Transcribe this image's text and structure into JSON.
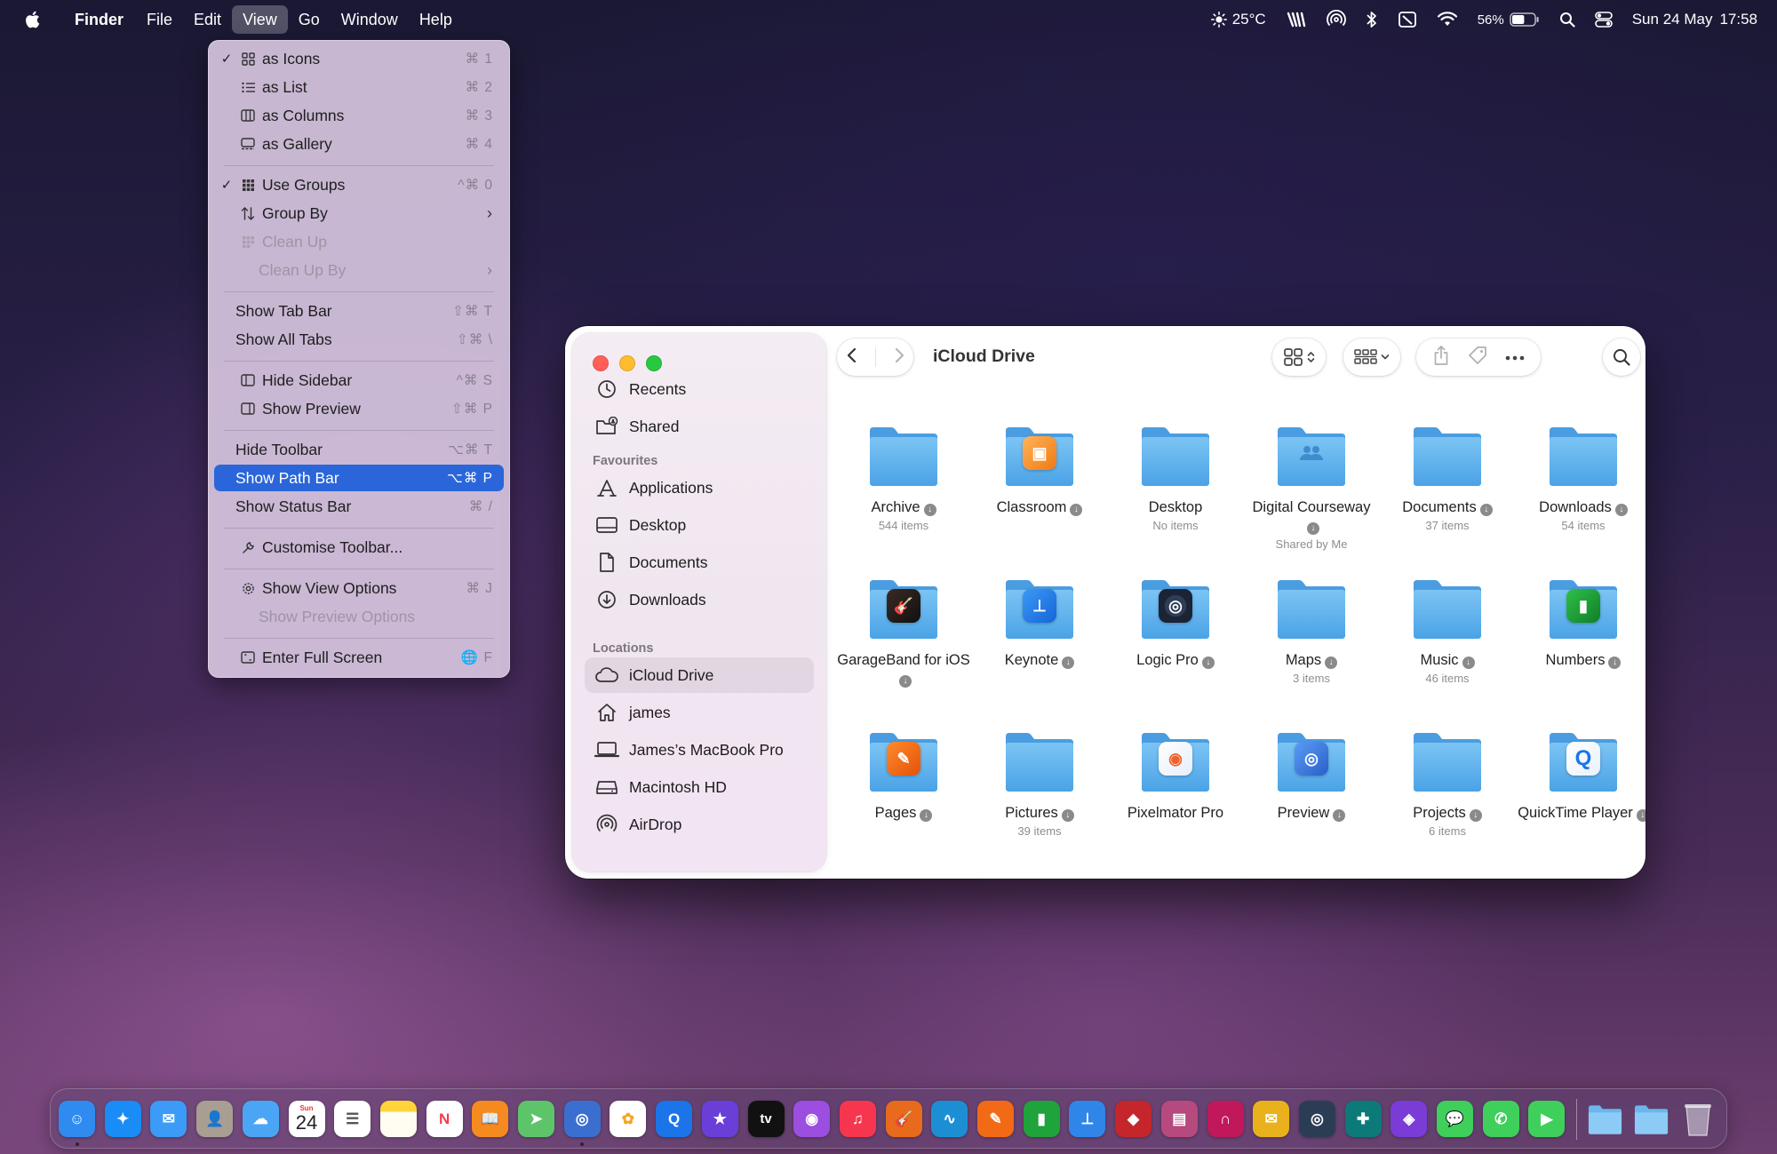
{
  "menubar": {
    "app_name": "Finder",
    "menus": [
      "File",
      "Edit",
      "View",
      "Go",
      "Window",
      "Help"
    ],
    "active_menu": "View",
    "weather": "25°C",
    "battery_percent": "56%",
    "battery_level": 0.56,
    "date": "Sun 24 May",
    "time": "17:58",
    "status_icons": [
      "sun-icon",
      "aggregate-icon",
      "airdrop-icon",
      "bluetooth-icon",
      "focus-icon",
      "wifi-icon",
      "battery-icon",
      "search-icon",
      "control-center-icon"
    ]
  },
  "view_menu": {
    "items": [
      {
        "label": "as Icons",
        "shortcut": "⌘ 1",
        "checked": true,
        "icon": "grid-icon"
      },
      {
        "label": "as List",
        "shortcut": "⌘ 2",
        "icon": "list-icon"
      },
      {
        "label": "as Columns",
        "shortcut": "⌘ 3",
        "icon": "columns-icon"
      },
      {
        "label": "as Gallery",
        "shortcut": "⌘ 4",
        "icon": "gallery-icon"
      },
      {
        "label": "Use Groups",
        "shortcut": "^⌘ 0",
        "checked": true,
        "icon": "groups-icon"
      },
      {
        "label": "Group By",
        "submenu": true,
        "icon": "sort-icon"
      },
      {
        "label": "Clean Up",
        "disabled": true,
        "icon": "cleanup-icon"
      },
      {
        "label": "Clean Up By",
        "disabled": true,
        "submenu": true
      },
      {
        "label": "Show Tab Bar",
        "shortcut": "⇧⌘ T"
      },
      {
        "label": "Show All Tabs",
        "shortcut": "⇧⌘ \\"
      },
      {
        "label": "Hide Sidebar",
        "shortcut": "^⌘ S",
        "icon": "sidebar-icon"
      },
      {
        "label": "Show Preview",
        "shortcut": "⇧⌘ P",
        "icon": "preview-icon"
      },
      {
        "label": "Hide Toolbar",
        "shortcut": "⌥⌘ T"
      },
      {
        "label": "Show Path Bar",
        "shortcut": "⌥⌘ P",
        "highlighted": true
      },
      {
        "label": "Show Status Bar",
        "shortcut": "⌘ /"
      },
      {
        "label": "Customise Toolbar...",
        "icon": "wrench-icon"
      },
      {
        "label": "Show View Options",
        "shortcut": "⌘ J",
        "icon": "gear-icon"
      },
      {
        "label": "Show Preview Options",
        "disabled": true
      },
      {
        "label": "Enter Full Screen",
        "shortcut": "🌐 F",
        "icon": "fullscreen-icon"
      }
    ]
  },
  "finder": {
    "title": "iCloud Drive",
    "sidebar": {
      "top_items": [
        {
          "label": "Recents",
          "icon": "clock-icon"
        },
        {
          "label": "Shared",
          "icon": "shared-folder-icon"
        }
      ],
      "favourites_header": "Favourites",
      "favourites": [
        {
          "label": "Applications",
          "icon": "applications-icon"
        },
        {
          "label": "Desktop",
          "icon": "desktop-icon"
        },
        {
          "label": "Documents",
          "icon": "document-icon"
        },
        {
          "label": "Downloads",
          "icon": "download-icon"
        }
      ],
      "locations_header": "Locations",
      "locations": [
        {
          "label": "iCloud Drive",
          "icon": "cloud-icon",
          "selected": true
        },
        {
          "label": "james",
          "icon": "home-icon"
        },
        {
          "label": "James’s MacBook Pro",
          "icon": "laptop-icon"
        },
        {
          "label": "Macintosh HD",
          "icon": "disk-icon"
        },
        {
          "label": "AirDrop",
          "icon": "airdrop-icon"
        }
      ]
    },
    "items": [
      {
        "name": "Archive",
        "sub": "544 items",
        "badge": ""
      },
      {
        "name": "Classroom",
        "sub": "",
        "badge": "classroom"
      },
      {
        "name": "Desktop",
        "sub": "No items",
        "badge": "",
        "no_download": true
      },
      {
        "name": "Digital Courseway",
        "sub": "Shared by Me",
        "badge": "people"
      },
      {
        "name": "Documents",
        "sub": "37 items",
        "badge": ""
      },
      {
        "name": "Downloads",
        "sub": "54 items",
        "badge": ""
      },
      {
        "name": "GarageBand for iOS",
        "sub": "",
        "badge": "garageband"
      },
      {
        "name": "Keynote",
        "sub": "",
        "badge": "keynote"
      },
      {
        "name": "Logic Pro",
        "sub": "",
        "badge": "logic"
      },
      {
        "name": "Maps",
        "sub": "3 items",
        "badge": ""
      },
      {
        "name": "Music",
        "sub": "46 items",
        "badge": ""
      },
      {
        "name": "Numbers",
        "sub": "",
        "badge": "numbers"
      },
      {
        "name": "Pages",
        "sub": "",
        "badge": "pages"
      },
      {
        "name": "Pictures",
        "sub": "39 items",
        "badge": ""
      },
      {
        "name": "Pixelmator Pro",
        "sub": "",
        "badge": "pixelmator",
        "no_download": true
      },
      {
        "name": "Preview",
        "sub": "",
        "badge": "preview"
      },
      {
        "name": "Projects",
        "sub": "6 items",
        "badge": ""
      },
      {
        "name": "QuickTime Player",
        "sub": "",
        "badge": "quicktime"
      }
    ]
  },
  "dock": {
    "calendar_month": "Sun",
    "calendar_day": "24",
    "tv_label": "tv",
    "apps": [
      {
        "name": "finder-icon",
        "color": "#2f8bf0"
      },
      {
        "name": "safari-icon",
        "color": "#1a8cf5"
      },
      {
        "name": "mail-icon",
        "color": "#3b9bf7"
      },
      {
        "name": "contacts-icon",
        "color": "#a89e92"
      },
      {
        "name": "icloud-icon",
        "color": "#4aa6f5"
      },
      {
        "name": "calendar-icon",
        "color": "#ffffff"
      },
      {
        "name": "reminders-icon",
        "color": "#ffffff"
      },
      {
        "name": "notes-icon",
        "color": "#ffd43a"
      },
      {
        "name": "news-icon",
        "color": "#ffffff"
      },
      {
        "name": "books-icon",
        "color": "#f58a1f"
      },
      {
        "name": "maps-icon",
        "color": "#5ec46a"
      },
      {
        "name": "preview-icon",
        "color": "#3a6fd0"
      },
      {
        "name": "photos-icon",
        "color": "#ffffff"
      },
      {
        "name": "quicktime-icon",
        "color": "#1b74e8"
      },
      {
        "name": "imovie-icon",
        "color": "#6a3fd8"
      },
      {
        "name": "appletv-icon",
        "color": "#111111"
      },
      {
        "name": "podcasts-icon",
        "color": "#9b4ee0"
      },
      {
        "name": "music-icon",
        "color": "#f6364f"
      },
      {
        "name": "garageband-icon",
        "color": "#e86a1c"
      },
      {
        "name": "freeform-icon",
        "color": "#1c8fd4"
      },
      {
        "name": "pages-icon",
        "color": "#f26a16"
      },
      {
        "name": "numbers-icon",
        "color": "#1fa33b"
      },
      {
        "name": "keynote-icon",
        "color": "#2f86e8"
      },
      {
        "name": "stack-icon",
        "color": "#c4262b"
      },
      {
        "name": "clapper-icon",
        "color": "#b6497e"
      },
      {
        "name": "affinity-icon",
        "color": "#c1185b"
      },
      {
        "name": "mail-star-icon",
        "color": "#e9b21c"
      },
      {
        "name": "logic-icon",
        "color": "#2b3d55"
      },
      {
        "name": "app-teal-icon",
        "color": "#0d7a7a"
      },
      {
        "name": "shortcuts-icon",
        "color": "#7b3bd6"
      },
      {
        "name": "messages-icon",
        "color": "#3fcf5b"
      },
      {
        "name": "phone-icon",
        "color": "#3fcf5b"
      },
      {
        "name": "facetime-icon",
        "color": "#3fcf5b"
      }
    ],
    "folders": [
      "applications-folder-icon",
      "downloads-folder-icon",
      "trash-icon"
    ]
  }
}
